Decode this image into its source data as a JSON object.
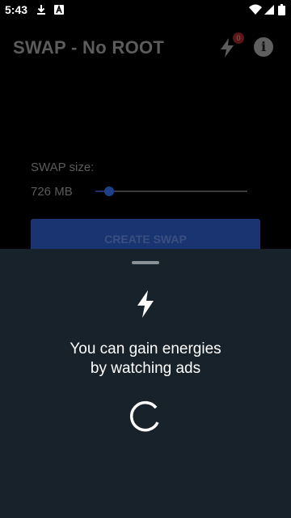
{
  "status_bar": {
    "time": "5:43",
    "left_icons": [
      "download-icon",
      "a-notification-icon"
    ],
    "right_icons": [
      "wifi-icon",
      "cell-signal-icon",
      "battery-icon"
    ]
  },
  "app_bar": {
    "title": "SWAP - No ROOT",
    "energy_icon": "bolt-icon",
    "energy_badge": "0",
    "info_icon": "info-icon",
    "info_glyph": "i"
  },
  "content": {
    "swap_size_label": "SWAP size:",
    "swap_size_value": "726 MB",
    "slider_fraction": 0.09,
    "create_button_label": "CREATE SWAP"
  },
  "sheet": {
    "icon": "bolt-icon",
    "line1": "You can gain energies",
    "line2": "by watching ads",
    "loading_icon": "spinner-icon"
  },
  "colors": {
    "background": "#000000",
    "sheet": "#17222a",
    "accent": "#1f3f8a",
    "badge": "#5a1717"
  }
}
